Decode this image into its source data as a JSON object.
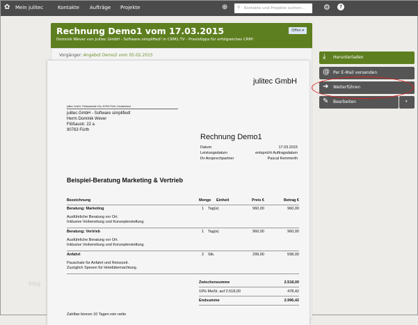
{
  "nav": {
    "brand": "Mein julitec",
    "items": [
      "Kontakte",
      "Aufträge",
      "Projekte"
    ],
    "search_placeholder": "Kontakte und Projekte suchen..."
  },
  "header": {
    "title": "Rechnung Demo1 vom 17.03.2015",
    "subtitle": "Dominik Wever von julitec GmbH - Software simplified! in CRM1.TV - Praxistipps für erfolgreiches CRM!",
    "status": "Offen ▾"
  },
  "predecessor": {
    "label": "Vorgänger:",
    "link": "Angebot Demo2 vom 05.02.2015"
  },
  "actions": [
    "Herunterladen",
    "Per E-Mail versenden",
    "Weiterführen",
    "Bearbeiten"
  ],
  "doc": {
    "company": "julitec GmbH",
    "sender_line": "julitec GmbH, Flößaustraße 22a, 90763 Fürth, Deutschland",
    "address": [
      "julitec GmbH - Software simplified!",
      "Herrn Dominik Wever",
      "Flößaustr. 22 a",
      "90763 Fürth"
    ],
    "title": "Rechnung Demo1",
    "meta": [
      [
        "Datum",
        "17.03.2015"
      ],
      [
        "Leistungsdatum",
        "entspricht Auftragsdatum"
      ],
      [
        "Ihr Ansprechpartner",
        "Pascal Kemmerth"
      ]
    ],
    "heading": "Beispiel-Beratung Marketing & Vertrieb",
    "columns": [
      "Bezeichnung",
      "Menge",
      "Einheit",
      "Preis €",
      "Betrag €"
    ],
    "rows": [
      {
        "name": "Beratung: Marketing",
        "qty": "1",
        "unit": "Tag(e)",
        "price": "960,00",
        "amount": "960,00",
        "desc1": "Ausführliche Beratung vor Ort.",
        "desc2": "Inklusive Vorbereitung und Konzepterstellung."
      },
      {
        "name": "Beratung: Vertrieb",
        "qty": "1",
        "unit": "Tag(e)",
        "price": "960,00",
        "amount": "960,00",
        "desc1": "Ausführliche Beratung vor Ort.",
        "desc2": "Inklusive Vorbereitung und Konzepterstellung."
      },
      {
        "name": "Anfahrt",
        "qty": "2",
        "unit": "Stk.",
        "price": "299,00",
        "amount": "598,00",
        "desc1": "Pauschale für Anfahrt und Reisezeit.",
        "desc2": "Zuzüglich  Spesen für Hotelübernachtung."
      }
    ],
    "totals": [
      [
        "Zwischensumme",
        "2.518,00"
      ],
      [
        "19% MwSt. auf 2.518,00",
        "478,42"
      ],
      [
        "Endsumme",
        "2.996,42"
      ]
    ],
    "footer": "Zahlbar binnen 10 Tagen rein netto"
  },
  "watermark": "blog"
}
